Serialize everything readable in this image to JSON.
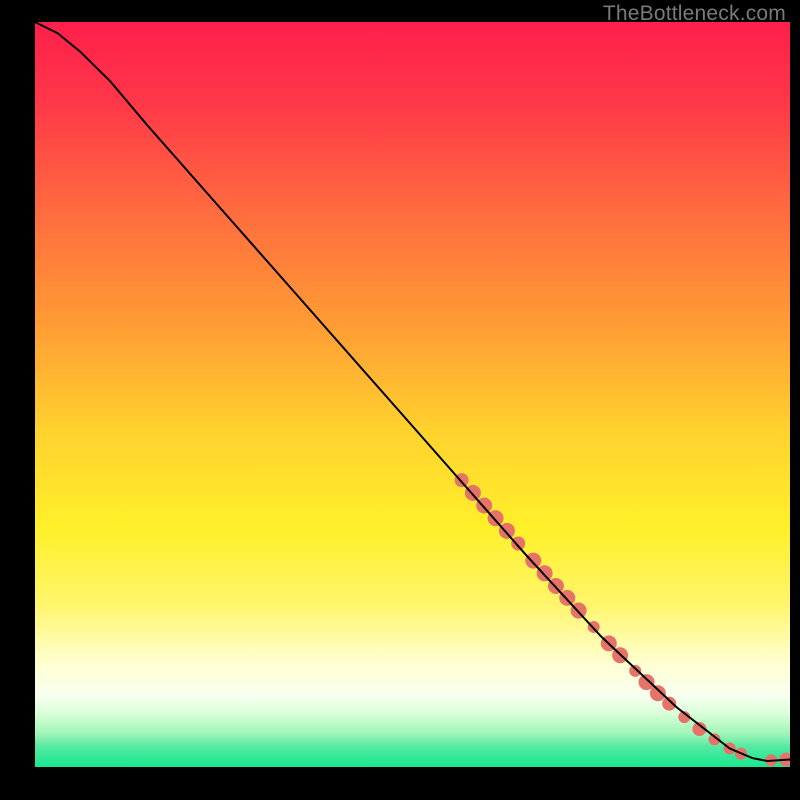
{
  "attribution": "TheBottleneck.com",
  "chart_data": {
    "type": "line",
    "title": "",
    "xlabel": "",
    "ylabel": "",
    "xlim": [
      0,
      100
    ],
    "ylim": [
      0,
      100
    ],
    "grid": false,
    "legend": false,
    "background_gradient": {
      "stops": [
        {
          "pos": 0.0,
          "color": "#ff1f4b"
        },
        {
          "pos": 0.1,
          "color": "#ff3549"
        },
        {
          "pos": 0.25,
          "color": "#ff6a3f"
        },
        {
          "pos": 0.4,
          "color": "#ff9a35"
        },
        {
          "pos": 0.55,
          "color": "#ffd22e"
        },
        {
          "pos": 0.68,
          "color": "#fff02a"
        },
        {
          "pos": 0.78,
          "color": "#fff56a"
        },
        {
          "pos": 0.86,
          "color": "#ffffd0"
        },
        {
          "pos": 0.905,
          "color": "#f8fff0"
        },
        {
          "pos": 0.93,
          "color": "#d6ffd6"
        },
        {
          "pos": 0.955,
          "color": "#9ff5b8"
        },
        {
          "pos": 0.975,
          "color": "#4ee8a0"
        },
        {
          "pos": 1.0,
          "color": "#17e88e"
        }
      ]
    },
    "series": [
      {
        "name": "bottleneck-curve",
        "stroke": "#000000",
        "points": [
          {
            "x": 0.0,
            "y": 100.0
          },
          {
            "x": 3.0,
            "y": 98.5
          },
          {
            "x": 6.0,
            "y": 96.0
          },
          {
            "x": 10.0,
            "y": 92.0
          },
          {
            "x": 15.0,
            "y": 86.0
          },
          {
            "x": 25.0,
            "y": 74.5
          },
          {
            "x": 35.0,
            "y": 63.0
          },
          {
            "x": 45.0,
            "y": 51.5
          },
          {
            "x": 55.0,
            "y": 40.0
          },
          {
            "x": 65.0,
            "y": 28.5
          },
          {
            "x": 75.0,
            "y": 17.5
          },
          {
            "x": 85.0,
            "y": 8.0
          },
          {
            "x": 92.0,
            "y": 2.5
          },
          {
            "x": 95.0,
            "y": 1.2
          },
          {
            "x": 97.0,
            "y": 0.8
          },
          {
            "x": 100.0,
            "y": 1.0
          }
        ]
      }
    ],
    "markers": {
      "name": "highlighted-segments",
      "color": "#e57368",
      "clusters": [
        {
          "x_start": 56,
          "x_end": 63,
          "density": "dense"
        },
        {
          "x_start": 63,
          "x_end": 66,
          "density": "medium"
        },
        {
          "x_start": 66,
          "x_end": 73,
          "density": "dense"
        },
        {
          "x_start": 74,
          "x_end": 78,
          "density": "medium"
        },
        {
          "x_start": 79,
          "x_end": 84,
          "density": "medium"
        },
        {
          "x_start": 85,
          "x_end": 89,
          "density": "sparse"
        },
        {
          "x_start": 90,
          "x_end": 94,
          "density": "sparse"
        },
        {
          "x_start": 97,
          "x_end": 100,
          "density": "end-pair"
        }
      ],
      "points": [
        {
          "x": 56.5,
          "y": 38.5,
          "r": 7
        },
        {
          "x": 58.0,
          "y": 36.8,
          "r": 8
        },
        {
          "x": 59.5,
          "y": 35.1,
          "r": 8
        },
        {
          "x": 61.0,
          "y": 33.4,
          "r": 8
        },
        {
          "x": 62.5,
          "y": 31.7,
          "r": 8
        },
        {
          "x": 64.0,
          "y": 30.0,
          "r": 7
        },
        {
          "x": 66.0,
          "y": 27.7,
          "r": 8
        },
        {
          "x": 67.5,
          "y": 26.0,
          "r": 8
        },
        {
          "x": 69.0,
          "y": 24.3,
          "r": 8
        },
        {
          "x": 70.5,
          "y": 22.7,
          "r": 8
        },
        {
          "x": 72.0,
          "y": 21.0,
          "r": 8
        },
        {
          "x": 74.0,
          "y": 18.8,
          "r": 6
        },
        {
          "x": 76.0,
          "y": 16.6,
          "r": 8
        },
        {
          "x": 77.5,
          "y": 15.0,
          "r": 8
        },
        {
          "x": 79.5,
          "y": 12.9,
          "r": 6
        },
        {
          "x": 81.0,
          "y": 11.4,
          "r": 8
        },
        {
          "x": 82.5,
          "y": 9.9,
          "r": 8
        },
        {
          "x": 84.0,
          "y": 8.5,
          "r": 7
        },
        {
          "x": 86.0,
          "y": 6.7,
          "r": 6
        },
        {
          "x": 88.0,
          "y": 5.1,
          "r": 7
        },
        {
          "x": 90.0,
          "y": 3.7,
          "r": 6
        },
        {
          "x": 92.0,
          "y": 2.5,
          "r": 6
        },
        {
          "x": 93.5,
          "y": 1.8,
          "r": 6
        },
        {
          "x": 97.5,
          "y": 0.9,
          "r": 6
        },
        {
          "x": 99.5,
          "y": 1.0,
          "r": 7
        }
      ]
    }
  }
}
